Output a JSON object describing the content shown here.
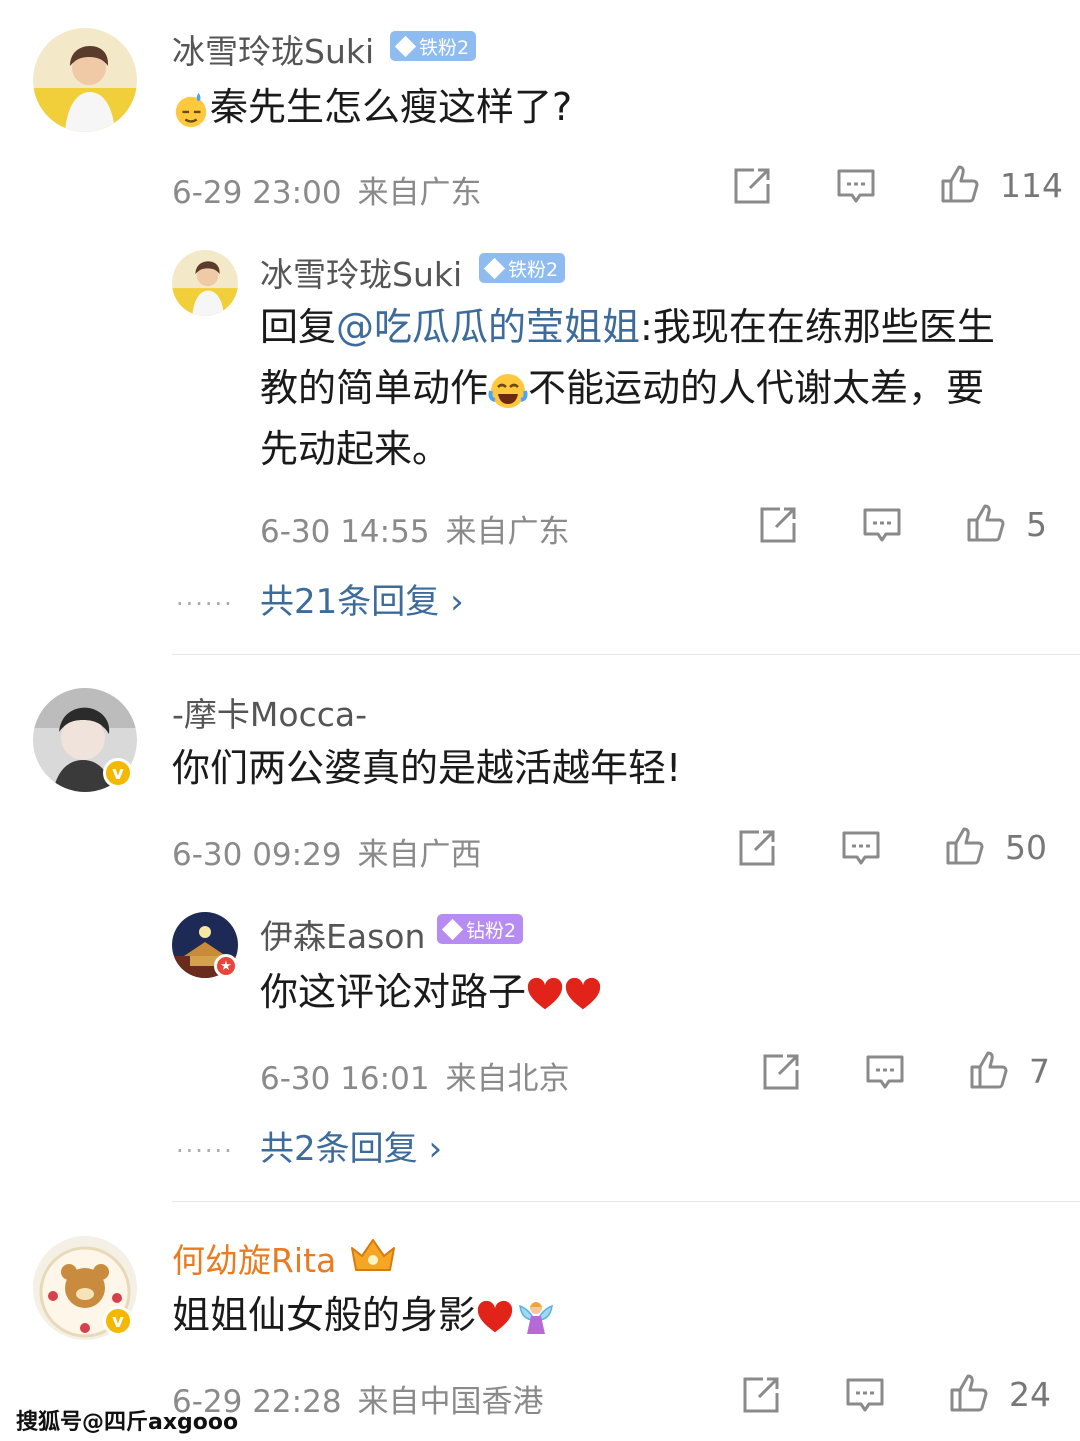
{
  "watermark": "搜狐号@四斤axgooo",
  "comments": [
    {
      "user": "冰雪玲珑Suki",
      "badge": "铁粉2",
      "text": "秦先生怎么瘦这样了?",
      "time": "6-29 23:00",
      "location": "来自广东",
      "likes": "114",
      "reply": {
        "user": "冰雪玲珑Suki",
        "badge": "铁粉2",
        "prefix": "回复",
        "mention": "@吃瓜瓜的莹姐姐",
        "line1": ":我现在在练那些医生",
        "line2a": "教的简单动作",
        "line2b": "不能运动的人代谢太差，要",
        "line3": "先动起来。",
        "time": "6-30 14:55",
        "location": "来自广东",
        "likes": "5"
      },
      "more": "共21条回复 ›"
    },
    {
      "user": "-摩卡Mocca-",
      "text": "你们两公婆真的是越活越年轻!",
      "time": "6-30 09:29",
      "location": "来自广西",
      "likes": "50",
      "reply": {
        "user": "伊森Eason",
        "badge": "钻粉2",
        "text": "你这评论对路子",
        "time": "6-30 16:01",
        "location": "来自北京",
        "likes": "7"
      },
      "more": "共2条回复 ›"
    },
    {
      "user": "何幼旋Rita",
      "text": "姐姐仙女般的身影",
      "time": "6-29 22:28",
      "location": "来自中国香港",
      "likes": "24"
    }
  ],
  "icons": {
    "share": "share-icon",
    "comment": "comment-icon",
    "like": "like-icon",
    "more": "ellipsis-dots"
  },
  "colors": {
    "mention": "#3d6b9c",
    "gold_name": "#ea7b1f",
    "iron_badge": "#8fbcf0",
    "diamond_badge": "#b78cf2",
    "verified": "#f5b800"
  }
}
